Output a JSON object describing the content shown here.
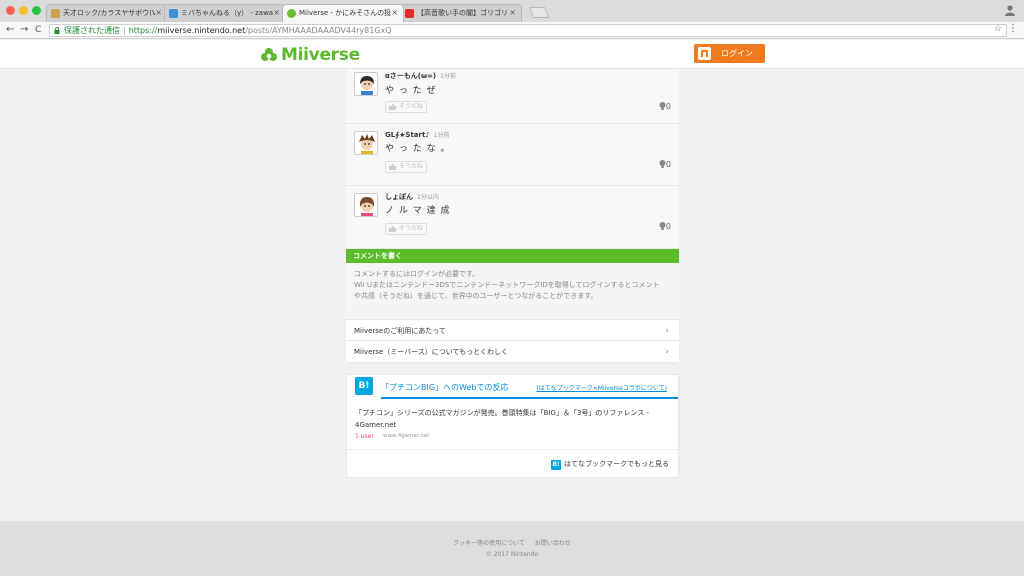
{
  "browser": {
    "tabs": [
      {
        "title": "天才ロック/カラスヤサボウ(Vo.歌",
        "favicon_color": "#c9a24a"
      },
      {
        "title": "ミバちゃんねる（y） - zawazawa",
        "favicon_color": "#3e8fd6"
      },
      {
        "title": "Miiverse - かにみそさんの投稿 |",
        "favicon_color": "#6abf2f",
        "active": true
      },
      {
        "title": "【高音歌い手の闇】ゴリゴリじ◀",
        "favicon_color": "#e22a2a"
      }
    ],
    "close_glyph": "×",
    "back_glyph": "←",
    "forward_glyph": "→",
    "reload_glyph": "C",
    "secure_label": "保護された通信",
    "url_scheme": "https://",
    "url_host": "miiverse.nintendo.net",
    "url_path": "/posts/AYMHAAADAAADV44ry81GxQ",
    "star_glyph": "☆",
    "menu_glyph": "⋮",
    "icons": [
      "lock-icon",
      "star-icon",
      "profile-icon",
      "menu-icon"
    ]
  },
  "header": {
    "logo_text": "Miiverse",
    "login_label": "ログイン",
    "brand_color": "#5cb82e",
    "login_color": "#f07b1f"
  },
  "comments": [
    {
      "name": "αさーもん(ω∞)",
      "time": "1分前",
      "body": "や っ た ぜ",
      "yeah": "そうだね",
      "empathy": "0"
    },
    {
      "name": "GL∮★Start♪",
      "time": "1分前",
      "body": " や っ た な 。",
      "yeah": "そうだね",
      "empathy": "0"
    },
    {
      "name": "しょぼん",
      "time": "1分以内",
      "body": "ノ ル マ 達 成",
      "yeah": "そうだね",
      "empathy": "0"
    }
  ],
  "write": {
    "heading": "コメントを書く",
    "line1": "コメントするにはログインが必要です。",
    "line2": "Wii Uまたはニンテンドー3DSでニンテンドーネットワークIDを取得してログインするとコメント",
    "line3": "や共感（そうだね）を通じて、世界中のユーザーとつながることができます。"
  },
  "links": [
    {
      "label": "Miiverseのご利用にあたって"
    },
    {
      "label": "Miiverse（ミーバース）についてもっとくわしく"
    }
  ],
  "chevron_glyph": "›",
  "hatena": {
    "logo": "B!",
    "title": "「プチコンBIG」へのWebでの反応",
    "subtitle": "(はてなブックマーク×Miiverseコラボについて)",
    "entry_line1": "「プチコン」シリーズの公式マガジンが発売。巻頭特集は「BIG」＆「3号」のリファレンス -",
    "entry_line2": "4Gamer.net",
    "users": "1 user",
    "site": "www.4gamer.net",
    "more": "はてなブックマークでもっと見る",
    "accent": "#008fde"
  },
  "footer": {
    "cookie": "クッキー等の使用について",
    "contact": "お問い合わせ",
    "copyright": "© 2017 Nintendo"
  }
}
